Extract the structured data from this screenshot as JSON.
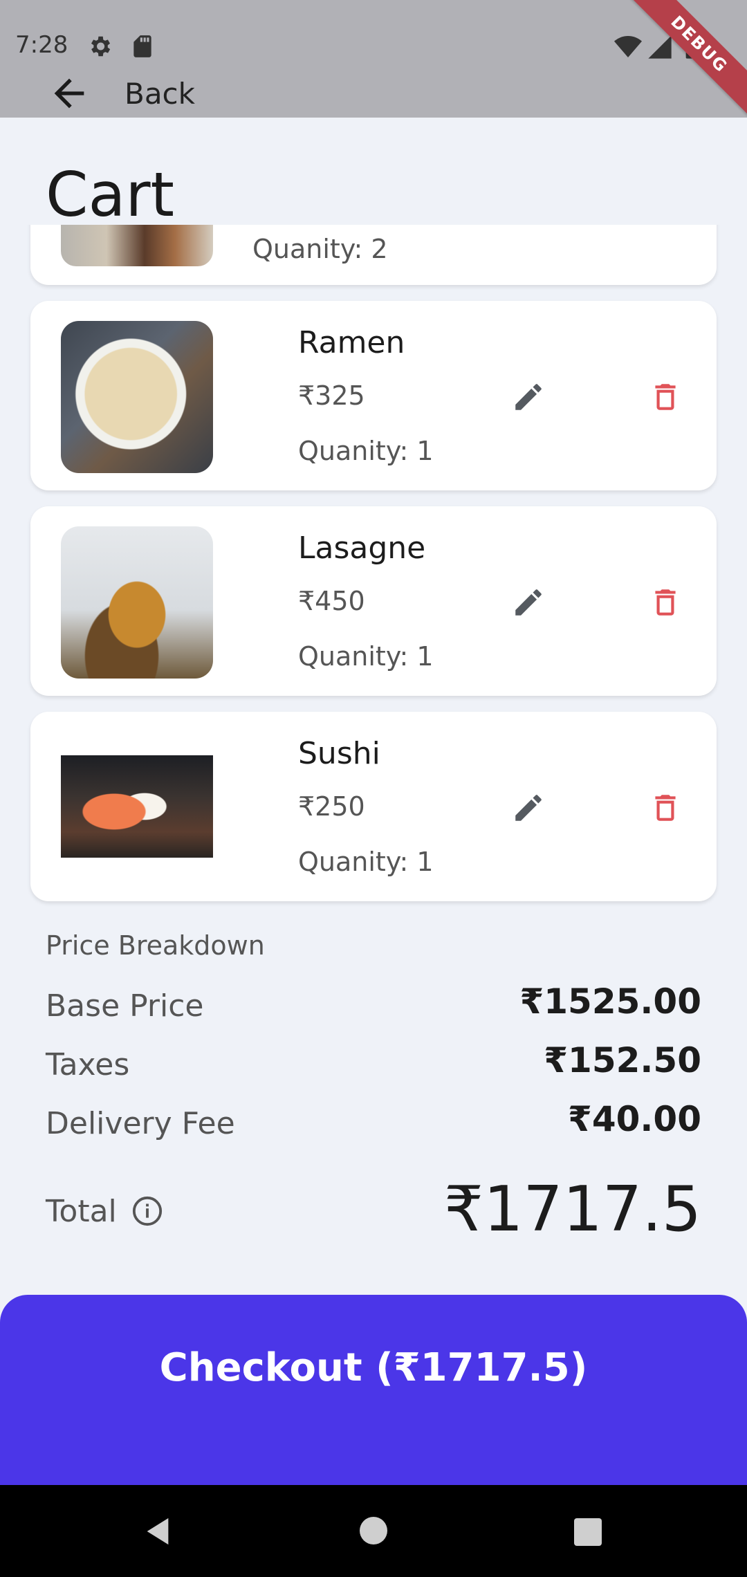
{
  "status_bar": {
    "time": "7:28",
    "left_icons": [
      "gear-icon",
      "sd-card-icon"
    ],
    "right_icons": [
      "wifi-icon",
      "signal-icon",
      "battery-icon"
    ],
    "debug_banner": "DEBUG"
  },
  "app_bar": {
    "back_label": "Back",
    "back_icon": "arrow-left-icon"
  },
  "page": {
    "title": "Cart"
  },
  "cart": {
    "partial_item": {
      "quantity": "Quanity: 2"
    },
    "items": [
      {
        "name": "Ramen",
        "price": "₹325",
        "quantity": "Quanity: 1"
      },
      {
        "name": "Lasagne",
        "price": "₹450",
        "quantity": "Quanity: 1"
      },
      {
        "name": "Sushi",
        "price": "₹250",
        "quantity": "Quanity: 1"
      }
    ],
    "edit_icon": "pencil-icon",
    "delete_icon": "trash-icon"
  },
  "breakdown": {
    "title": "Price Breakdown",
    "base_price_label": "Base Price",
    "base_price_value": "₹1525.00",
    "taxes_label": "Taxes",
    "taxes_value": "₹152.50",
    "delivery_label": "Delivery Fee",
    "delivery_value": "₹40.00",
    "total_label": "Total",
    "total_value": "₹1717.5"
  },
  "checkout": {
    "label": "Checkout (₹1717.5)"
  },
  "colors": {
    "accent": "#4b36e8",
    "delete": "#e05257",
    "background": "#eff2f8"
  }
}
